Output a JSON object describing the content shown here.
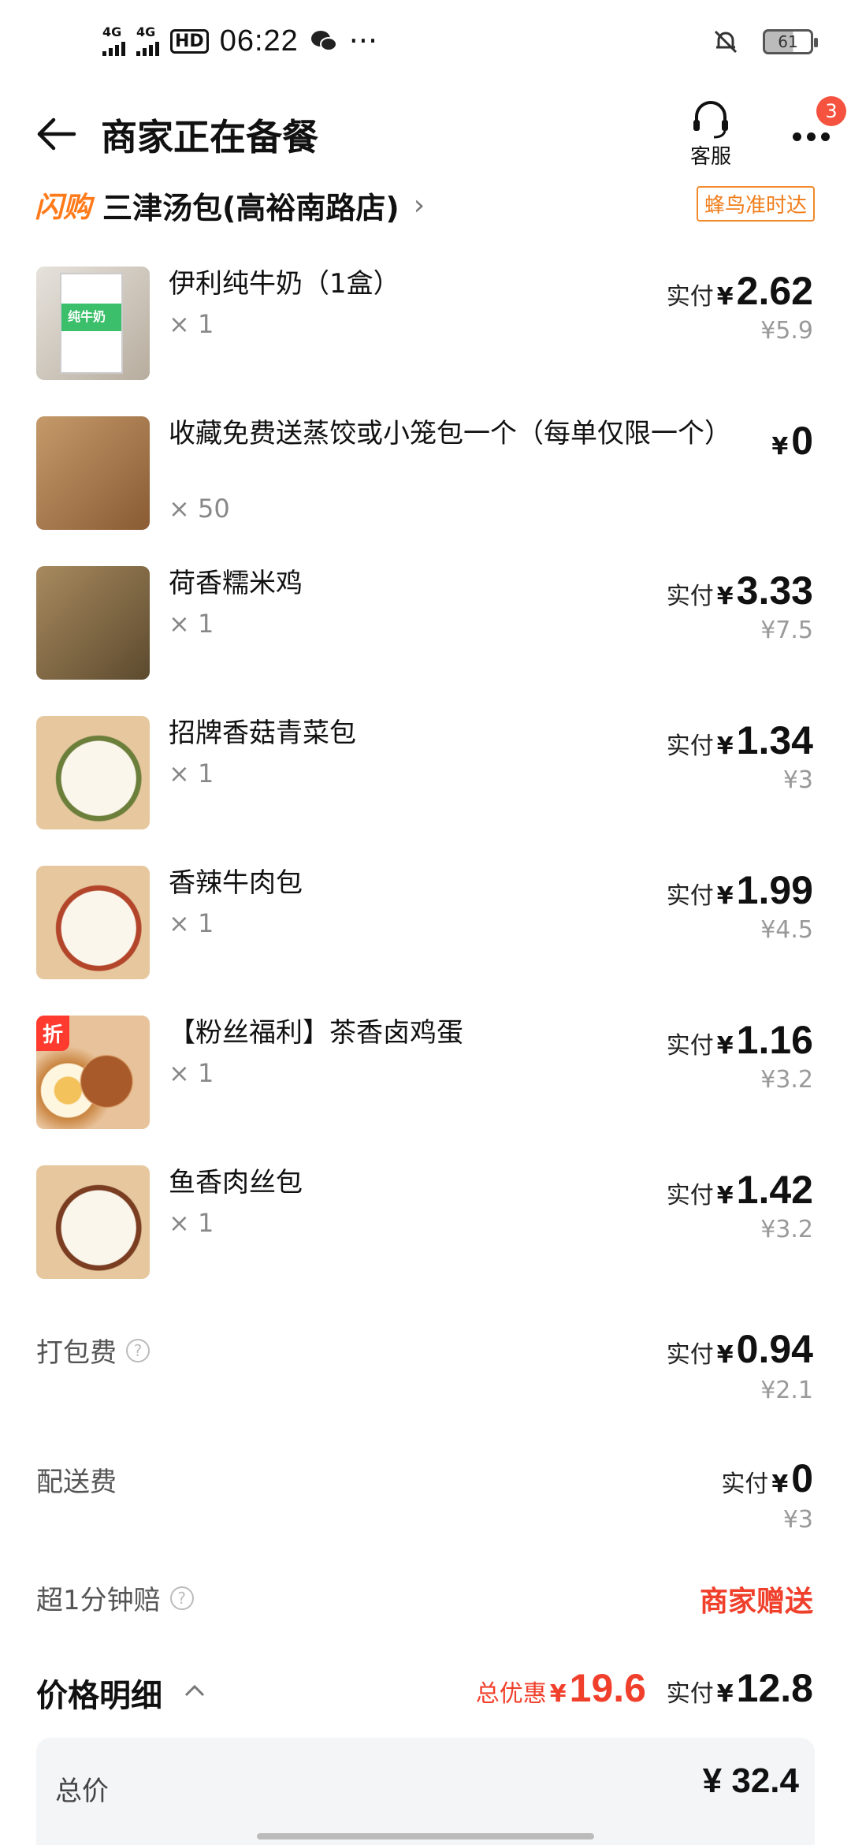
{
  "status_bar": {
    "network1": "4G",
    "network2": "4G",
    "hd": "HD",
    "time": "06:22",
    "more": "···",
    "battery": "61"
  },
  "header": {
    "title": "商家正在备餐",
    "service_label": "客服",
    "more_badge": "3"
  },
  "store": {
    "brand": "闪购",
    "name": "三津汤包(高裕南路店)",
    "chevron": "›",
    "delivery_badge": "蜂鸟准时达"
  },
  "items": [
    {
      "name": "伊利纯牛奶（1盒）",
      "qty": "× 1",
      "paid_label": "实付",
      "yen": "¥",
      "paid": "2.62",
      "orig": "¥5.9"
    },
    {
      "name": "收藏免费送蒸饺或小笼包一个（每单仅限一个）",
      "qty": "× 50",
      "yen": "¥",
      "paid": "0"
    },
    {
      "name": "荷香糯米鸡",
      "qty": "× 1",
      "paid_label": "实付",
      "yen": "¥",
      "paid": "3.33",
      "orig": "¥7.5"
    },
    {
      "name": "招牌香菇青菜包",
      "qty": "× 1",
      "paid_label": "实付",
      "yen": "¥",
      "paid": "1.34",
      "orig": "¥3"
    },
    {
      "name": "香辣牛肉包",
      "qty": "× 1",
      "paid_label": "实付",
      "yen": "¥",
      "paid": "1.99",
      "orig": "¥4.5"
    },
    {
      "name": "【粉丝福利】茶香卤鸡蛋",
      "qty": "× 1",
      "paid_label": "实付",
      "yen": "¥",
      "paid": "1.16",
      "orig": "¥3.2",
      "badge": "折"
    },
    {
      "name": "鱼香肉丝包",
      "qty": "× 1",
      "paid_label": "实付",
      "yen": "¥",
      "paid": "1.42",
      "orig": "¥3.2"
    }
  ],
  "milk_box_text": "纯牛奶",
  "fees": {
    "packing": {
      "label": "打包费",
      "paid_label": "实付",
      "yen": "¥",
      "paid": "0.94",
      "orig": "¥2.1"
    },
    "delivery": {
      "label": "配送费",
      "paid_label": "实付",
      "yen": "¥",
      "paid": "0",
      "orig": "¥3"
    },
    "late_comp": {
      "label": "超1分钟赔",
      "value": "商家赠送"
    }
  },
  "price_detail": {
    "title": "价格明细",
    "chevron": "^",
    "discount_label": "总优惠",
    "discount_yen": "¥",
    "discount_value": "19.6",
    "paid_label": "实付",
    "paid_yen": "¥",
    "paid_value": "12.8",
    "total_label": "总价",
    "total_value": "¥ 32.4"
  },
  "question_mark": "?",
  "colors": {
    "accent_red": "#f0402c",
    "accent_orange": "#ff7a1a"
  }
}
